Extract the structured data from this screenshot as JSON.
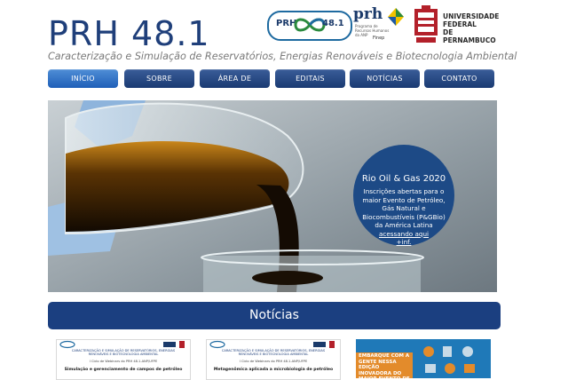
{
  "header": {
    "title": "PRH 48.1",
    "subtitle": "Caracterização e Simulação de Reservatórios, Energias Renováveis e Biotecnologia Ambiental"
  },
  "logos": {
    "prh_left": "PRH",
    "prh_right": "48.1",
    "anp_main": "prh",
    "anp_sub": "Programa de Recursos Humanos da ANP",
    "finep": "Finep",
    "ufpe": [
      "UNIVERSIDADE",
      "FEDERAL",
      "DE",
      "PERNAMBUCO"
    ]
  },
  "nav": {
    "items": [
      {
        "label": "INÍCIO",
        "active": true
      },
      {
        "label": "SOBRE",
        "active": false
      },
      {
        "label": "ÁREA DE ATUAÇÃO",
        "active": false
      },
      {
        "label": "EDITAIS",
        "active": false
      },
      {
        "label": "NOTÍCIAS",
        "active": false
      },
      {
        "label": "CONTATO",
        "active": false
      }
    ]
  },
  "promo": {
    "title": "Rio Oil & Gas 2020",
    "body": "Inscrições abertas para o maior Evento de Petróleo, Gás Natural e Biocombustíveis (P&GBio) da América Latina",
    "link": "acessando aqui",
    "more": "+inf."
  },
  "news": {
    "heading": "Notícias",
    "cards": [
      {
        "header": "CARACTERIZAÇÃO E SIMULAÇÃO DE RESERVATÓRIOS, ENERGIAS RENOVÁVEIS E BIOTECNOLOGIA AMBIENTAL",
        "cycle": "I Ciclo de Webinars do PRH 48.1-ANP/UFPE",
        "title": "Simulação e gerenciamento de campos de petróleo"
      },
      {
        "header": "CARACTERIZAÇÃO E SIMULAÇÃO DE RESERVATÓRIOS, ENERGIAS RENOVÁVEIS E BIOTECNOLOGIA AMBIENTAL",
        "cycle": "I Ciclo de Webinars do PRH 48.1-ANP/UFPE",
        "title": "Metagenômica aplicada a microbiologia de petróleo"
      },
      {
        "promo_text": "EMBARQUE COM A GENTE NESSA EDIÇÃO INOVADORA DO MAIOR EVENTO DE O&G DA"
      }
    ]
  },
  "colors": {
    "title": "#1f3f7a",
    "nav": "#1a3a72",
    "nav_active": "#1f5fb8",
    "news_bar": "#1b3f80",
    "promo_circle": "#1d4a86"
  }
}
